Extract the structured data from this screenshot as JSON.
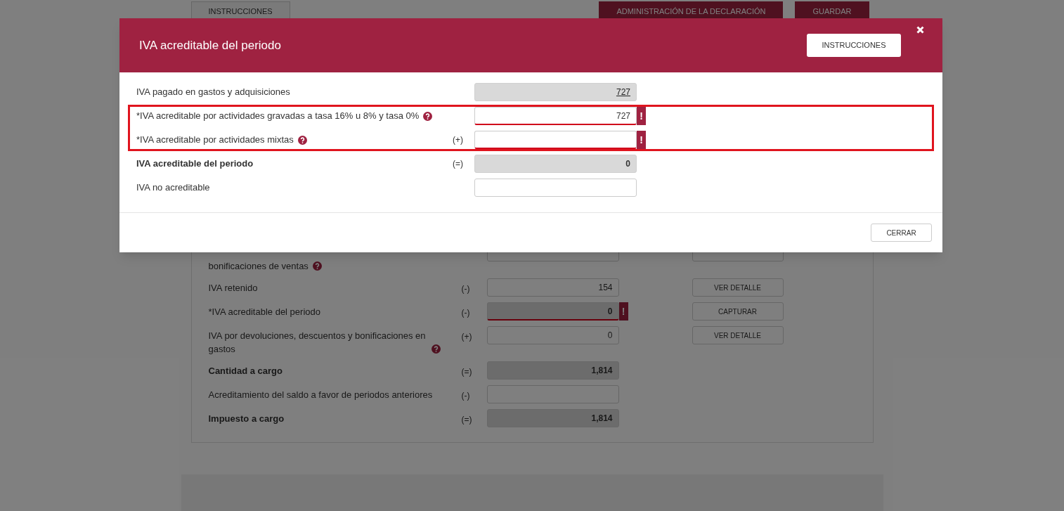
{
  "page": {
    "top_buttons": [
      {
        "label": "INSTRUCCIONES",
        "kind": "outline"
      },
      {
        "label": "ADMINISTRACIÓN DE LA DECLARACIÓN",
        "kind": "filled"
      },
      {
        "label": "GUARDAR",
        "kind": "filled"
      }
    ],
    "rows": [
      {
        "kind": "partial",
        "label": "bonificaciones de ventas",
        "help": true,
        "bold": false,
        "readonly": false
      },
      {
        "kind": "full",
        "label": "IVA retenido",
        "help": false,
        "bold": false,
        "operator": "(-)",
        "value": "154",
        "readonly": false,
        "action": "VER DETALLE"
      },
      {
        "kind": "full",
        "label": "*IVA acreditable del periodo",
        "help": false,
        "bold": false,
        "operator": "(-)",
        "value": "0",
        "readonly": true,
        "alert": "!",
        "action": "CAPTURAR"
      },
      {
        "kind": "full",
        "label": "IVA por devoluciones, descuentos y bonificaciones en gastos",
        "help": true,
        "bold": false,
        "operator": "(+)",
        "value": "0",
        "readonly": false,
        "action": "VER DETALLE"
      },
      {
        "kind": "full",
        "label": "Cantidad a cargo",
        "help": false,
        "bold": true,
        "operator": "(=)",
        "value": "1,814",
        "readonly": true
      },
      {
        "kind": "full",
        "label": "Acreditamiento del saldo a favor de periodos anteriores",
        "help": false,
        "bold": false,
        "operator": "(-)",
        "readonly": false
      },
      {
        "kind": "full",
        "label": "Impuesto a cargo",
        "help": false,
        "bold": true,
        "operator": "(=)",
        "value": "1,814",
        "readonly": true
      }
    ]
  },
  "modal": {
    "title": "IVA acreditable del periodo",
    "instructions_button": "INSTRUCCIONES",
    "close_button": "CERRAR",
    "rows": [
      {
        "label": "IVA pagado en gastos y adquisiciones",
        "help": false,
        "bold": false,
        "value": "727",
        "readonly": true,
        "link": true,
        "highlighted": false
      },
      {
        "label": "*IVA acreditable por actividades gravadas a tasa 16% u 8% y tasa 0%",
        "help": true,
        "bold": false,
        "value": "727",
        "readonly": false,
        "link": false,
        "alert": "!",
        "highlighted": true
      },
      {
        "label": "*IVA acreditable por actividades mixtas",
        "help": true,
        "bold": false,
        "operator": "(+)",
        "readonly": false,
        "alert": "!",
        "highlighted": true
      },
      {
        "label": "IVA acreditable del periodo",
        "help": false,
        "bold": true,
        "operator": "(=)",
        "value": "0",
        "readonly": true,
        "link": false,
        "highlighted": false
      },
      {
        "label": "IVA no acreditable",
        "help": false,
        "bold": false,
        "readonly": false,
        "highlighted": false
      }
    ]
  }
}
